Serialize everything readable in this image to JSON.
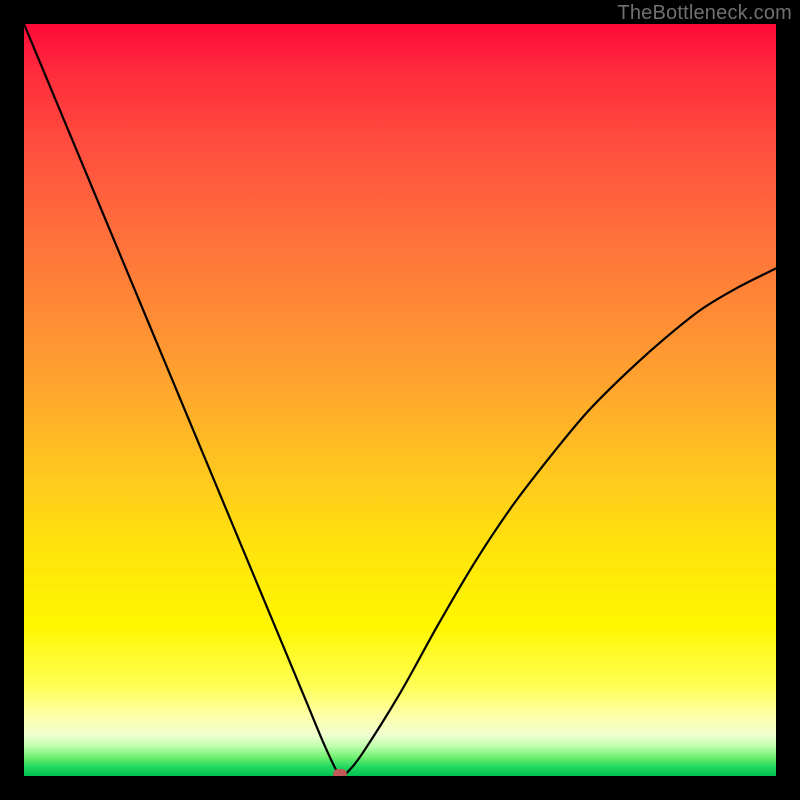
{
  "watermark": {
    "text": "TheBottleneck.com"
  },
  "colors": {
    "background": "#000000",
    "gradient_top": "#ff0a3a",
    "gradient_bottom": "#00c050",
    "curve": "#000000",
    "marker": "#c05858",
    "watermark_text": "#707070"
  },
  "chart_data": {
    "type": "line",
    "title": "",
    "xlabel": "",
    "ylabel": "",
    "xlim": [
      0,
      100
    ],
    "ylim": [
      0,
      100
    ],
    "x": [
      0,
      5,
      10,
      15,
      20,
      25,
      30,
      35,
      37.5,
      40,
      42,
      43,
      45,
      50,
      55,
      60,
      65,
      70,
      75,
      80,
      85,
      90,
      95,
      100
    ],
    "values": [
      100,
      88.0,
      76.0,
      64.0,
      52.0,
      40.0,
      28.0,
      16.0,
      10.0,
      4.0,
      0.0,
      0.5,
      3.0,
      11.0,
      20.0,
      28.5,
      36.0,
      42.5,
      48.5,
      53.5,
      58.0,
      62.0,
      65.0,
      67.5
    ],
    "minimum": {
      "x": 42,
      "y": 0
    },
    "marker": {
      "x": 42,
      "y": 0,
      "shape": "rounded-rect",
      "color": "#c05858"
    },
    "background_gradient": {
      "orientation": "vertical",
      "stops": [
        {
          "pos": 0.0,
          "color": "#ff0a3a"
        },
        {
          "pos": 0.5,
          "color": "#ffaa2c"
        },
        {
          "pos": 0.8,
          "color": "#fff600"
        },
        {
          "pos": 0.93,
          "color": "#ffffaa"
        },
        {
          "pos": 1.0,
          "color": "#00c050"
        }
      ]
    },
    "notes": "Axes have no visible tick labels; x and y are normalized 0–100 estimates read from pixel position. The curve falls steeply from top-left, reaches a sharp minimum (≈0) near x≈42, then rises on a concave-down path to the right edge at y≈67.5. A small rounded red marker sits at the minimum on the bottom edge."
  }
}
